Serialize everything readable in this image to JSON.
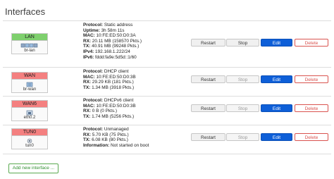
{
  "page": {
    "title": "Interfaces"
  },
  "colors": {
    "lan": "#7ed06d",
    "wan": "#f48080",
    "wan6": "#f48080",
    "tun0": "#f48080",
    "edit": "#0e5fd8",
    "delete": "#d9534f"
  },
  "buttons": {
    "restart": "Restart",
    "stop": "Stop",
    "edit": "Edit",
    "delete": "Delete"
  },
  "interfaces": [
    {
      "name": "LAN",
      "device": "br-lan",
      "icon": "bridge-icon",
      "details": [
        {
          "label": "Protocol:",
          "value": " Static address"
        },
        {
          "label": "Uptime:",
          "value": " 3h 58m 11s"
        },
        {
          "label": "MAC:",
          "value": " 10:FE:ED:50:D0:3A"
        },
        {
          "label": "RX:",
          "value": " 20.11 MB (158570 Pkts.)"
        },
        {
          "label": "TX:",
          "value": " 40.91 MB (99248 Pkts.)"
        },
        {
          "label": "IPv4:",
          "value": " 192.168.1.222/24"
        },
        {
          "label": "IPv6:",
          "value": " fddd:fa9e:5d5d::1/60"
        }
      ]
    },
    {
      "name": "WAN",
      "device": "br-wan",
      "icon": "bridge-icon",
      "details": [
        {
          "label": "Protocol:",
          "value": " DHCP client"
        },
        {
          "label": "MAC:",
          "value": " 10:FE:ED:50:D0:3B"
        },
        {
          "label": "RX:",
          "value": " 29.29 KB (181 Pkts.)"
        },
        {
          "label": "TX:",
          "value": " 1.34 MB (3918 Pkts.)"
        }
      ]
    },
    {
      "name": "WAN6",
      "device": "eth0.2",
      "icon": "ethernet-icon",
      "details": [
        {
          "label": "Protocol:",
          "value": " DHCPv6 client"
        },
        {
          "label": "MAC:",
          "value": " 10:FE:ED:50:D0:3B"
        },
        {
          "label": "RX:",
          "value": " 0 B (0 Pkts.)"
        },
        {
          "label": "TX:",
          "value": " 1.74 MB (5256 Pkts.)"
        }
      ]
    },
    {
      "name": "TUN0",
      "device": "tun0",
      "icon": "tunnel-icon",
      "details": [
        {
          "label": "Protocol:",
          "value": " Unmanaged"
        },
        {
          "label": "RX:",
          "value": " 5.70 KB (75 Pkts.)"
        },
        {
          "label": "TX:",
          "value": " 6.08 KB (80 Pkts.)"
        },
        {
          "label": "Information:",
          "value": " Not started on boot"
        }
      ]
    }
  ],
  "add_interface": "Add new interface ..."
}
